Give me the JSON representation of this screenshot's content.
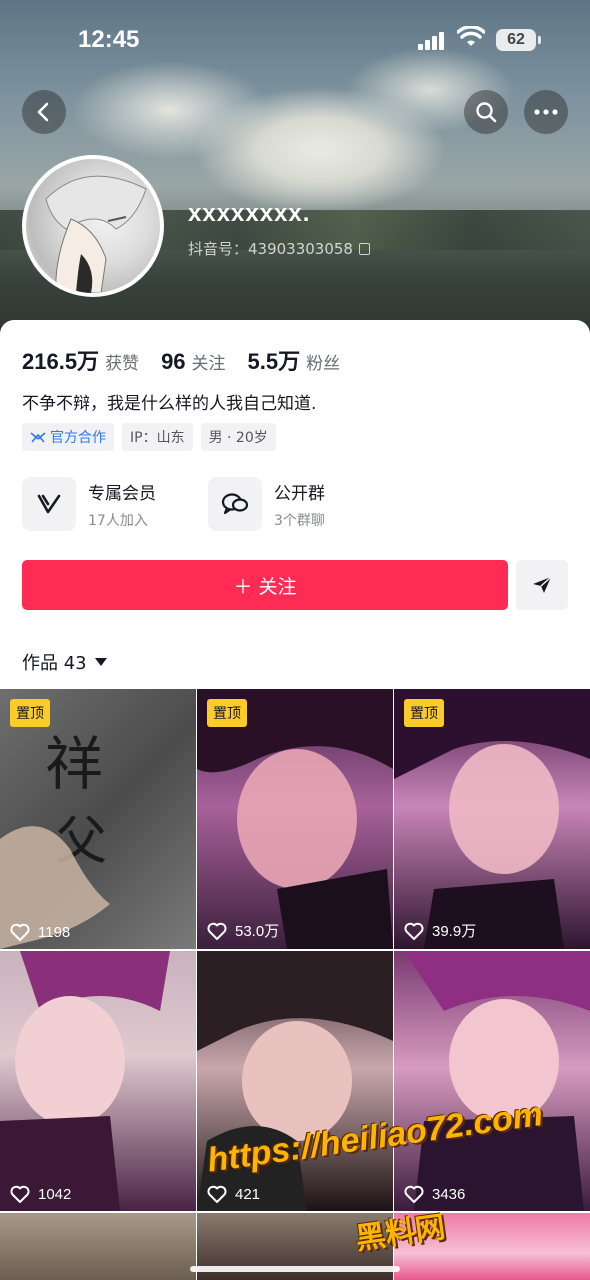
{
  "status": {
    "time": "12:45",
    "battery": "62"
  },
  "profile": {
    "username": "xxxxxxxx.",
    "douyin_id": "抖音号：43903303058",
    "stats": [
      {
        "num": "216.5万",
        "label": "获赞"
      },
      {
        "num": "96",
        "label": "关注"
      },
      {
        "num": "5.5万",
        "label": "粉丝"
      }
    ],
    "bio": "不争不辩，我是什么样的人我自己知道.",
    "tags": [
      "官方合作",
      "IP：山东",
      "男 · 20岁"
    ]
  },
  "features": [
    {
      "title": "专属会员",
      "sub": "17人加入",
      "icon": "vip-icon"
    },
    {
      "title": "公开群",
      "sub": "3个群聊",
      "icon": "group-chat-icon"
    }
  ],
  "follow_label": "＋ 关注",
  "works": {
    "label": "作品 43"
  },
  "videos": [
    {
      "pinned": "置顶",
      "likes": "1198"
    },
    {
      "pinned": "置顶",
      "likes": "53.0万"
    },
    {
      "pinned": "置顶",
      "likes": "39.9万"
    },
    {
      "pinned": "",
      "likes": "1042"
    },
    {
      "pinned": "",
      "likes": "421"
    },
    {
      "pinned": "",
      "likes": "3436"
    }
  ],
  "watermark": {
    "url": "https://heiliao72.com",
    "name": "黑料网"
  },
  "colors": {
    "primary": "#fe2c55",
    "pin": "#fbcb2a",
    "official": "#2b7bf0"
  }
}
